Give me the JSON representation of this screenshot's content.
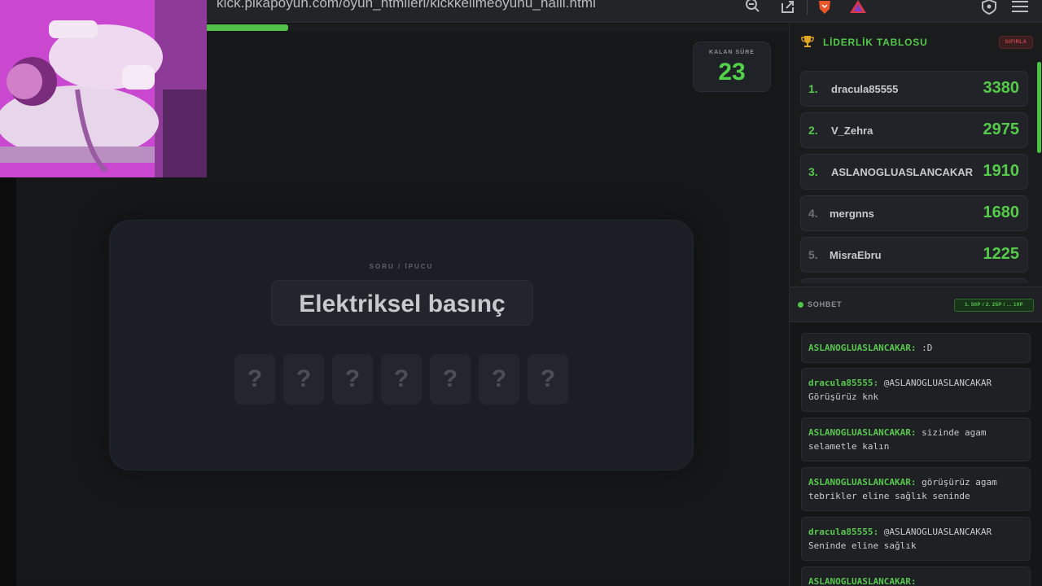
{
  "browser": {
    "url": "kick.pikapoyun.com/oyun_htmlleri/kickkelimeoyunu_halil.html",
    "icons": [
      "zoom-icon",
      "share-icon",
      "brave-lion-icon",
      "rewards-triangle-icon",
      "vpn-shield-icon",
      "menu-icon"
    ]
  },
  "game": {
    "progress_fraction": 0.14,
    "timer": {
      "label": "KALAN SÜRE",
      "value": "23"
    },
    "hint_label": "SORU / İPUCU",
    "hint": "Elektriksel basınç",
    "tiles": [
      "?",
      "?",
      "?",
      "?",
      "?",
      "?",
      "?"
    ]
  },
  "leaderboard": {
    "title": "LİDERLİK TABLOSU",
    "reset_label": "SIFIRLA",
    "rows": [
      {
        "rank": "1.",
        "name": "dracula85555",
        "score": "3380"
      },
      {
        "rank": "2.",
        "name": "V_Zehra",
        "score": "2975"
      },
      {
        "rank": "3.",
        "name": "ASLANOGLUASLANCAKAR",
        "score": "1910"
      },
      {
        "rank": "4.",
        "name": "mergnns",
        "score": "1680"
      },
      {
        "rank": "5.",
        "name": "MisraEbru",
        "score": "1225"
      }
    ],
    "colors": {
      "top_rank": "#56c94c",
      "other_rank": "#6c7178"
    }
  },
  "chat": {
    "title": "SOHBET",
    "badge": "1. 50P / 2. 25P / ... 10P",
    "messages": [
      {
        "user": "ASLANOGLUASLANCAKAR:",
        "text": " :D"
      },
      {
        "user": "dracula85555:",
        "text": " @ASLANOGLUASLANCAKAR Görüşürüz knk"
      },
      {
        "user": "ASLANOGLUASLANCAKAR:",
        "text": " sizinde agam selametle kalın"
      },
      {
        "user": "ASLANOGLUASLANCAKAR:",
        "text": " görüşürüz agam tebrikler eline sağlık seninde"
      },
      {
        "user": "dracula85555:",
        "text": " @ASLANOGLUASLANCAKAR Seninde eline sağlık"
      },
      {
        "user": "ASLANOGLUASLANCAKAR:",
        "text": ""
      }
    ]
  },
  "colors": {
    "accent": "#53c94a",
    "danger": "#d0484e",
    "panel": "#1a1b1d"
  }
}
